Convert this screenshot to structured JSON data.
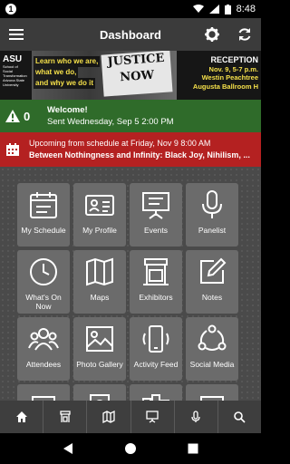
{
  "status": {
    "time": "8:48",
    "notif_count": "1"
  },
  "appbar": {
    "title": "Dashboard"
  },
  "banner": {
    "tagline_line1": "Learn who we are,",
    "tagline_line2": "what we do,",
    "tagline_line3": "and why we do it",
    "asu_name": "ASU",
    "asu_line1": "School of",
    "asu_line2": "Social",
    "asu_line3": "Transformation",
    "asu_line4": "Arizona State",
    "asu_line5": "University",
    "sign_line1": "JUSTICE",
    "sign_line2": "NOW",
    "reception_title": "RECEPTION",
    "reception_date": "Nov. 9, 5-7 p.m.",
    "reception_venue": "Westin Peachtree",
    "reception_room": "Augusta Ballroom H"
  },
  "welcome": {
    "count": "0",
    "title": "Welcome!",
    "subtitle": "Sent Wednesday, Sep 5 2:00 PM"
  },
  "schedule": {
    "line1": "Upcoming from schedule at Friday, Nov 9 8:00 AM",
    "line2": "Between Nothingness and Infinity: Black Joy, Nihilism, ..."
  },
  "tiles": [
    {
      "label": "My Schedule",
      "icon": "calendar-icon"
    },
    {
      "label": "My Profile",
      "icon": "id-card-icon"
    },
    {
      "label": "Events",
      "icon": "presentation-icon"
    },
    {
      "label": "Panelist",
      "icon": "microphone-icon"
    },
    {
      "label": "What's On Now",
      "icon": "clock-icon"
    },
    {
      "label": "Maps",
      "icon": "map-icon"
    },
    {
      "label": "Exhibitors",
      "icon": "booth-icon"
    },
    {
      "label": "Notes",
      "icon": "notes-icon"
    },
    {
      "label": "Attendees",
      "icon": "attendees-icon"
    },
    {
      "label": "Photo Gallery",
      "icon": "photo-icon"
    },
    {
      "label": "Activity Feed",
      "icon": "phone-icon"
    },
    {
      "label": "Social Media",
      "icon": "share-icon"
    },
    {
      "label": "",
      "icon": "documents-icon"
    },
    {
      "label": "",
      "icon": "passport-icon"
    },
    {
      "label": "",
      "icon": "city-icon"
    },
    {
      "label": "",
      "icon": "building-icon"
    }
  ],
  "bottomnav": [
    {
      "icon": "home-icon"
    },
    {
      "icon": "booth-icon"
    },
    {
      "icon": "map-icon"
    },
    {
      "icon": "presentation-icon"
    },
    {
      "icon": "microphone-icon"
    },
    {
      "icon": "search-icon"
    }
  ],
  "colors": {
    "appbar": "#3b3b3b",
    "welcome": "#2f6b2a",
    "schedule": "#b42121",
    "tile": "#6b6b6b",
    "accent_yellow": "#f5e04a"
  }
}
